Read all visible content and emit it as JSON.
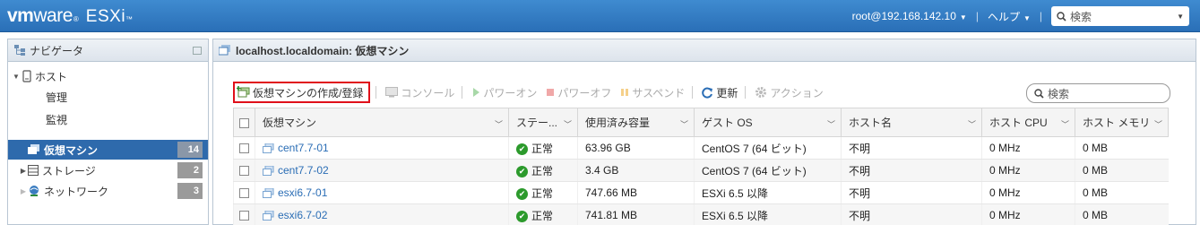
{
  "app": {
    "brand_vm": "vm",
    "brand_ware": "ware",
    "brand_reg": "®",
    "brand_product": "ESXi",
    "brand_tm": "™",
    "user": "root@192.168.142.10",
    "help": "ヘルプ",
    "search_placeholder": "検索"
  },
  "navigator": {
    "title": "ナビゲータ",
    "host": "ホスト",
    "manage": "管理",
    "monitor": "監視",
    "items": [
      {
        "label": "仮想マシン",
        "count": "14",
        "icon": "vm-icon"
      },
      {
        "label": "ストレージ",
        "count": "2",
        "icon": "storage-icon"
      },
      {
        "label": "ネットワーク",
        "count": "3",
        "icon": "network-icon"
      }
    ]
  },
  "main": {
    "title": "localhost.localdomain: 仮想マシン",
    "toolbar": {
      "create": "仮想マシンの作成/登録",
      "console": "コンソール",
      "power_on": "パワーオン",
      "power_off": "パワーオフ",
      "suspend": "サスペンド",
      "refresh": "更新",
      "actions": "アクション"
    },
    "search_placeholder": "検索",
    "columns": [
      "仮想マシン",
      "ステー...",
      "使用済み容量",
      "ゲスト OS",
      "ホスト名",
      "ホスト CPU",
      "ホスト メモリ"
    ],
    "rows": [
      {
        "name": "cent7.7-01",
        "status": "正常",
        "used": "63.96 GB",
        "os": "CentOS 7 (64 ビット)",
        "host": "不明",
        "cpu": "0 MHz",
        "mem": "0 MB"
      },
      {
        "name": "cent7.7-02",
        "status": "正常",
        "used": "3.4 GB",
        "os": "CentOS 7 (64 ビット)",
        "host": "不明",
        "cpu": "0 MHz",
        "mem": "0 MB"
      },
      {
        "name": "esxi6.7-01",
        "status": "正常",
        "used": "747.66 MB",
        "os": "ESXi 6.5 以降",
        "host": "不明",
        "cpu": "0 MHz",
        "mem": "0 MB"
      },
      {
        "name": "esxi6.7-02",
        "status": "正常",
        "used": "741.81 MB",
        "os": "ESXi 6.5 以降",
        "host": "不明",
        "cpu": "0 MHz",
        "mem": "0 MB"
      }
    ]
  },
  "colors": {
    "header_blue": "#2a6fb7",
    "selected_nav": "#2e6aac",
    "highlight_red": "#e0101a",
    "status_ok": "#2c9a2c",
    "link": "#2a6db5"
  }
}
